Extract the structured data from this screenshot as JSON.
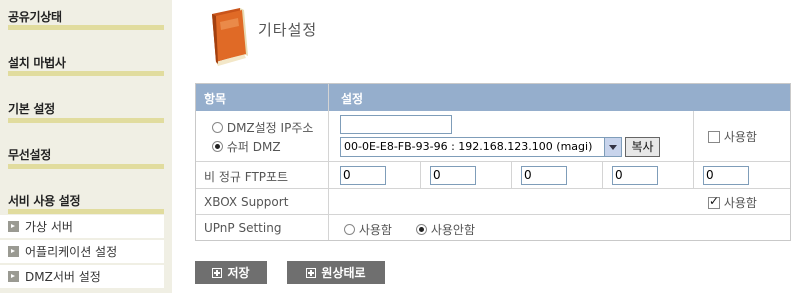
{
  "sidebar": {
    "sections": [
      {
        "title": "공유기상태"
      },
      {
        "title": "설치 마법사"
      },
      {
        "title": "기본 설정"
      },
      {
        "title": "무선설정"
      },
      {
        "title": "서비 사용 설정"
      }
    ],
    "sub_items": [
      {
        "label": "가상 서버"
      },
      {
        "label": "어플리케이션 설정"
      },
      {
        "label": "DMZ서버 설정"
      }
    ]
  },
  "header": {
    "title": "기타설정",
    "icon": "book-icon"
  },
  "table": {
    "col_item": "항목",
    "col_setting": "설정",
    "dmz": {
      "option_ip_label": "DMZ설정 IP주소",
      "option_ip_selected": false,
      "ip_value": "",
      "option_super_label": "슈퍼 DMZ",
      "option_super_selected": true,
      "mac_select_value": "00-0E-E8-FB-93-96 : 192.168.123.100 (magi)",
      "copy_label": "복사",
      "enable_label": "사용함",
      "enable_checked": false
    },
    "ftp": {
      "label": "비 정규 FTP포트",
      "ports": [
        "0",
        "0",
        "0",
        "0",
        "0"
      ]
    },
    "xbox": {
      "label": "XBOX Support",
      "enable_label": "사용함",
      "enable_checked": true
    },
    "upnp": {
      "label": "UPnP Setting",
      "on_label": "사용함",
      "on_selected": false,
      "off_label": "사용안함",
      "off_selected": true
    }
  },
  "buttons": {
    "save_label": "저장",
    "reset_label": "원상태로"
  },
  "colors": {
    "header_bg": "#95aecc",
    "sidebar_bg": "#f0efe4",
    "sidebar_bar": "#e1dc9e",
    "button_bg": "#6f6f6f"
  }
}
